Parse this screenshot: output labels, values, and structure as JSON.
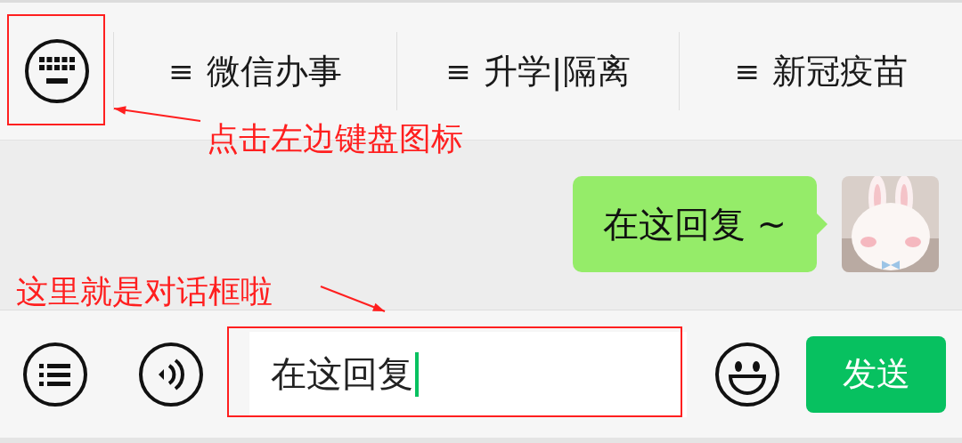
{
  "menu_bar": {
    "items": [
      {
        "icon": "≡",
        "label": "微信办事"
      },
      {
        "icon": "≡",
        "label": "升学|隔离"
      },
      {
        "icon": "≡",
        "label": "新冠疫苗"
      }
    ]
  },
  "messages": [
    {
      "text": "在这回复 ~"
    }
  ],
  "input_bar": {
    "value": "在这回复",
    "send_button": "发送"
  },
  "annotations": [
    {
      "text": "点击左边键盘图标"
    },
    {
      "text": "这里就是对话框啦"
    }
  ]
}
